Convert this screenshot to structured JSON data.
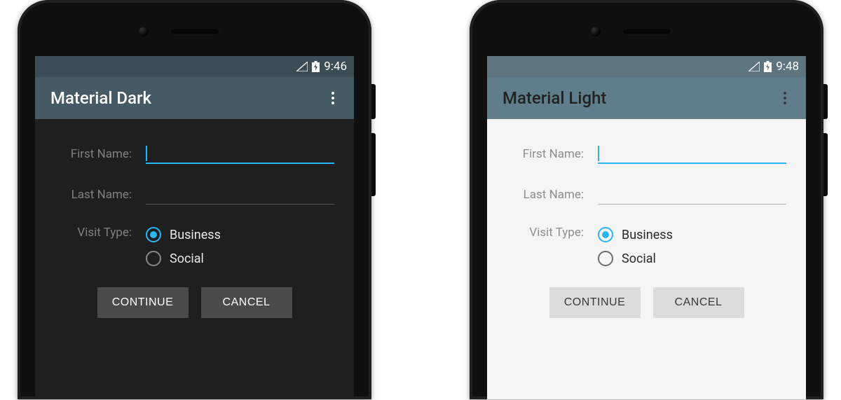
{
  "accent_color": "#29b6f6",
  "dark": {
    "time": "9:46",
    "title": "Material Dark",
    "fields": {
      "first_name_label": "First Name:",
      "last_name_label": "Last Name:",
      "visit_type_label": "Visit Type:"
    },
    "radios": {
      "business": "Business",
      "social": "Social",
      "selected": "business"
    },
    "buttons": {
      "continue": "CONTINUE",
      "cancel": "CANCEL"
    },
    "colors": {
      "statusbar": "#3b4c54",
      "appbar": "#455a64",
      "content_bg": "#1f1f1f",
      "button_bg": "#4a4a4a"
    }
  },
  "light": {
    "time": "9:48",
    "title": "Material Light",
    "fields": {
      "first_name_label": "First Name:",
      "last_name_label": "Last Name:",
      "visit_type_label": "Visit Type:"
    },
    "radios": {
      "business": "Business",
      "social": "Social",
      "selected": "business"
    },
    "buttons": {
      "continue": "CONTINUE",
      "cancel": "CANCEL"
    },
    "colors": {
      "statusbar": "#5e747e",
      "appbar": "#607d8b",
      "content_bg": "#f5f5f5",
      "button_bg": "#dcdcdc"
    }
  }
}
